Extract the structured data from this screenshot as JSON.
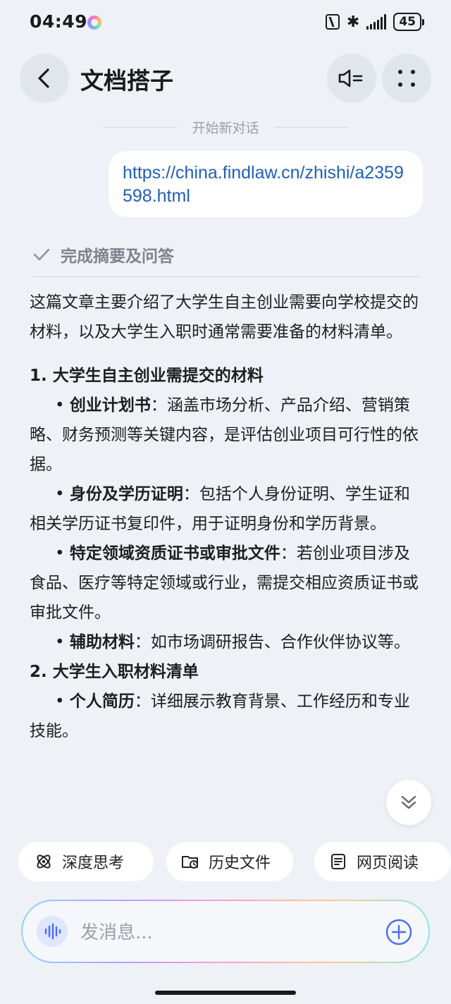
{
  "status_bar": {
    "time": "04:49",
    "battery": "45"
  },
  "header": {
    "title": "文档搭子"
  },
  "conversation": {
    "new_chat_label": "开始新对话",
    "user_message": "https://china.findlaw.cn/zhishi/a2359598.html",
    "status_text": "完成摘要及问答"
  },
  "answer": {
    "intro": "这篇文章主要介绍了大学生自主创业需要向学校提交的材料，以及大学生入职时通常需要准备的材料清单。",
    "section1": {
      "title": "1. 大学生自主创业需提交的材料",
      "items": [
        {
          "term": "创业计划书",
          "desc": "：涵盖市场分析、产品介绍、营销策略、财务预测等关键内容，是评估创业项目可行性的依据。"
        },
        {
          "term": "身份及学历证明",
          "desc": "：包括个人身份证明、学生证和相关学历证书复印件，用于证明身份和学历背景。"
        },
        {
          "term": "特定领域资质证书或审批文件",
          "desc": "：若创业项目涉及食品、医疗等特定领域或行业，需提交相应资质证书或审批文件。"
        },
        {
          "term": "辅助材料",
          "desc": "：如市场调研报告、合作伙伴协议等。"
        }
      ]
    },
    "section2": {
      "title": "2. 大学生入职材料清单",
      "items": [
        {
          "term": "个人简历",
          "desc": "：详细展示教育背景、工作经历和专业技能。"
        }
      ]
    }
  },
  "quick_actions": [
    "深度思考",
    "历史文件",
    "网页阅读"
  ],
  "input": {
    "placeholder": "发消息..."
  },
  "colors": {
    "link": "#1f5fb8",
    "background": "#eef1f6",
    "accent": "#4a6cf7"
  }
}
